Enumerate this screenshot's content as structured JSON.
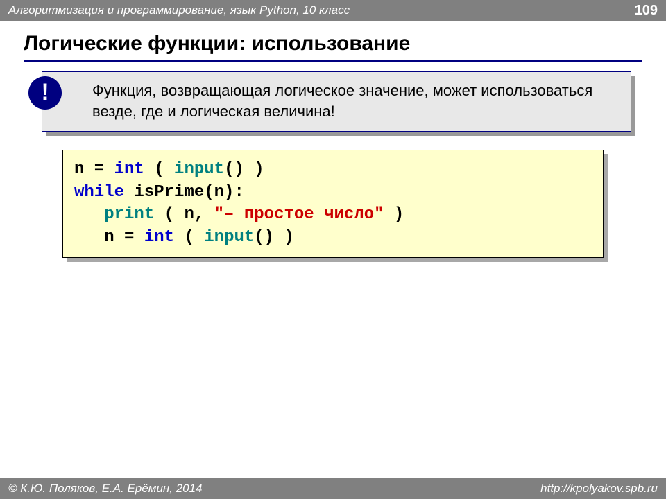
{
  "header": {
    "course": "Алгоритмизация и программирование, язык Python, 10 класс",
    "page": "109"
  },
  "title": "Логические функции: использование",
  "callout": {
    "mark": "!",
    "text": "Функция, возвращающая логическое значение, может использоваться везде, где и логическая величина!"
  },
  "code": {
    "line1": {
      "a": "n = ",
      "b": "int",
      "c": " ( ",
      "d": "input",
      "e": "() )"
    },
    "line2": {
      "a": "while",
      "b": " isPrime(n):"
    },
    "line3": {
      "indent": "   ",
      "a": "print",
      "b": " ( n, ",
      "c": "\"– простое число\"",
      "d": " )"
    },
    "line4": {
      "indent": "   ",
      "a": "n = ",
      "b": "int",
      "c": " ( ",
      "d": "input",
      "e": "() )"
    }
  },
  "footer": {
    "authors": "© К.Ю. Поляков, Е.А. Ерёмин, 2014",
    "url": "http://kpolyakov.spb.ru"
  }
}
